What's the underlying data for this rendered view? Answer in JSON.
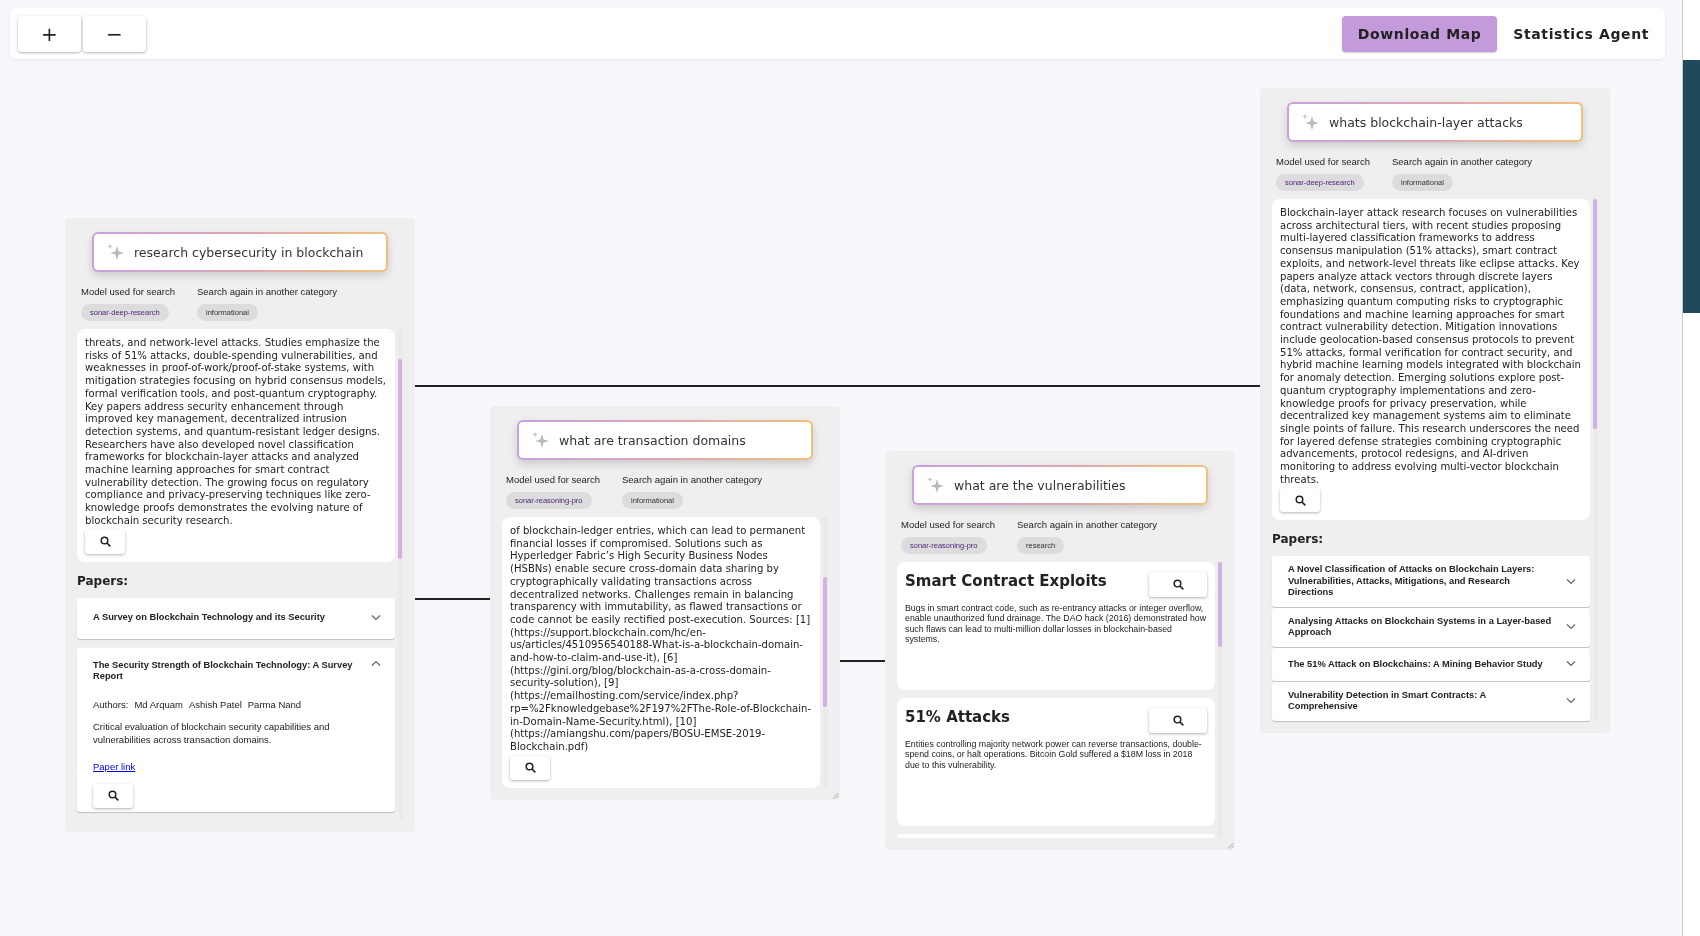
{
  "toolbar": {
    "zoom_buttons": [
      "+",
      "−"
    ],
    "download_button": "Download Map",
    "agent_button": "Statistics Agent"
  },
  "nodes": [
    {
      "query": "research cybersecurity in blockchain",
      "model_label": "Model used for search",
      "model": "sonar-deep-research",
      "category_label": "Search again in another category",
      "category": "informational",
      "content": {
        "kind": "summary",
        "text": "threats, and network-level attacks. Studies emphasize the risks of 51% attacks, double-spending vulnerabilities, and weaknesses in proof-of-work/proof-of-stake systems, with mitigation strategies focusing on hybrid consensus models, formal verification tools, and post-quantum cryptography. Key papers address security enhancement through improved key management, decentralized intrusion detection systems, and quantum-resistant ledger designs. Researchers have also developed novel classification frameworks for blockchain-layer attacks and analyzed machine learning approaches for smart contract vulnerability detection. The growing focus on regulatory compliance and privacy-preserving techniques like zero-knowledge proofs demonstrates the evolving nature of blockchain security research."
      },
      "papers_heading": "Papers:",
      "papers": [
        {
          "title": "A Survey on Blockchain Technology and its Security",
          "expanded": false
        },
        {
          "title": "The Security Strength of Blockchain Technology: A Survey Report",
          "expanded": true,
          "authors_label": "Authors:",
          "authors": [
            "Md Arquam",
            "Ashish Patel",
            "Parma Nand"
          ],
          "description": "Critical evaluation of blockchain security capabilities and vulnerabilities across transaction domains.",
          "link": "Paper link"
        }
      ]
    },
    {
      "query": "what are transaction domains",
      "model_label": "Model used for search",
      "model": "sonar-reasoning-pro",
      "category_label": "Search again in another category",
      "category": "informational",
      "content": {
        "kind": "summary",
        "text": "of blockchain-ledger entries, which can lead to permanent financial losses if compromised. Solutions such as Hyperledger Fabric’s High Security Business Nodes (HSBNs) enable secure cross-domain data sharing by cryptographically validating transactions across decentralized networks. Challenges remain in balancing transparency with immutability, as flawed transactions or code cannot be easily rectified post-execution. Sources: [1] (https://support.blockchain.com/hc/en-us/articles/4510956540188-What-is-a-blockchain-domain-and-how-to-claim-and-use-it), [6] (https://gini.org/blog/blockchain-as-a-cross-domain-security-solution), [9] (https://emailhosting.com/service/index.php? rp=%2Fknowledgebase%2F197%2FThe-Role-of-Blockchain-in-Domain-Name-Security.html), [10] (https://amiangshu.com/papers/BOSU-EMSE-2019-Blockchain.pdf)"
      },
      "resizable": true
    },
    {
      "query": "what are the vulnerabilities",
      "model_label": "Model used for search",
      "model": "sonar-reasoning-pro",
      "category_label": "Search again in another category",
      "category": "research",
      "content": {
        "kind": "cards",
        "more_below": true,
        "items": [
          {
            "title": "Smart Contract Exploits",
            "text": "Bugs in smart contract code, such as re-entrancy attacks or integer overflow, enable unauthorized fund drainage. The DAO hack (2016) demonstrated how such flaws can lead to multi-million dollar losses in blockchain-based systems."
          },
          {
            "title": "51% Attacks",
            "text": "Entities controlling majority network power can reverse transactions, double-spend coins, or halt operations. Bitcoin Gold suffered a $18M loss in 2018 due to this vulnerability."
          }
        ]
      },
      "resizable": true
    },
    {
      "query": "whats blockchain-layer attacks",
      "model_label": "Model used for search",
      "model": "sonar-deep-research",
      "category_label": "Search again in another category",
      "category": "informational",
      "content": {
        "kind": "summary",
        "text": "Blockchain-layer attack research focuses on vulnerabilities across architectural tiers, with recent studies proposing multi-layered classification frameworks to address consensus manipulation (51% attacks), smart contract exploits, and network-level threats like eclipse attacks. Key papers analyze attack vectors through discrete layers (data, network, consensus, contract, application), emphasizing quantum computing risks to cryptographic foundations and machine learning approaches for smart contract vulnerability detection. Mitigation innovations include geolocation-based consensus protocols to prevent 51% attacks, formal verification for contract security, and hybrid machine learning models integrated with blockchain for anomaly detection. Emerging solutions explore post-quantum cryptography implementations and zero-knowledge proofs for privacy preservation, while decentralized key management systems aim to eliminate single points of failure. This research underscores the need for layered defense strategies combining cryptographic advancements, protocol redesigns, and AI-driven monitoring to address evolving multi-vector blockchain threats."
      },
      "papers_heading": "Papers:",
      "papers": [
        {
          "title": "A Novel Classification of Attacks on Blockchain Layers: Vulnerabilities, Attacks, Mitigations, and Research Directions",
          "expanded": false
        },
        {
          "title": "Analysing Attacks on Blockchain Systems in a Layer-based Approach",
          "expanded": false
        },
        {
          "title": "The 51% Attack on Blockchains: A Mining Behavior Study",
          "expanded": false
        },
        {
          "title": "Vulnerability Detection in Smart Contracts: A Comprehensive",
          "expanded": false
        }
      ]
    }
  ]
}
